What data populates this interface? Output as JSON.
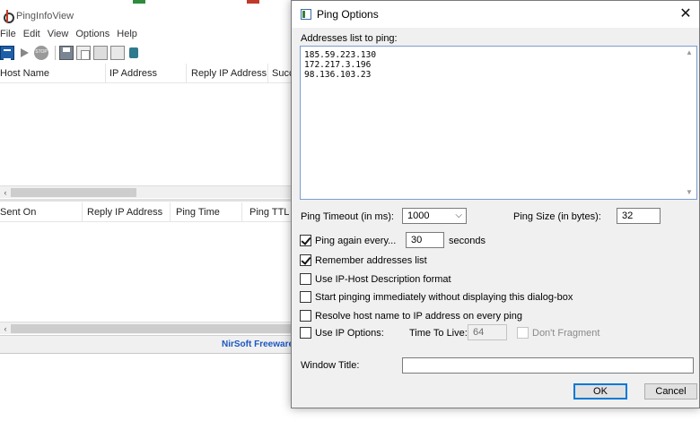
{
  "main_window": {
    "title": "PingInfoView",
    "menu": [
      "File",
      "Edit",
      "View",
      "Options",
      "Help"
    ],
    "toolbar_icons": [
      "list-icon",
      "play-icon",
      "stop-icon",
      "save-icon",
      "copy-icon",
      "html-report-icon",
      "properties-icon",
      "exit-icon"
    ],
    "top_columns": [
      "Host Name",
      "IP Address",
      "Reply IP Address",
      "Succ"
    ],
    "bottom_columns": [
      "Sent On",
      "Reply IP Address",
      "Ping Time",
      "Ping TTL"
    ],
    "status_text": "NirSoft Freeware"
  },
  "dialog": {
    "title": "Ping Options",
    "close_glyph": "✕",
    "addresses_label": "Addresses list to ping:",
    "addresses": [
      "185.59.223.130",
      "172.217.3.196",
      "98.136.103.23"
    ],
    "ping_timeout_label": "Ping Timeout (in ms):",
    "ping_timeout_value": "1000",
    "ping_size_label": "Ping Size (in bytes):",
    "ping_size_value": "32",
    "ping_again_label": "Ping again every...",
    "ping_again_checked": true,
    "ping_again_value": "30",
    "seconds_label": "seconds",
    "remember_label": "Remember addresses list",
    "remember_checked": true,
    "iphost_label": "Use IP-Host Description format",
    "iphost_checked": false,
    "start_immediately_label": "Start pinging immediately without displaying this dialog-box",
    "start_immediately_checked": false,
    "resolve_label": "Resolve host name to IP address on every ping",
    "resolve_checked": false,
    "ip_options_label": "Use IP Options:",
    "ip_options_checked": false,
    "ttl_label": "Time To Live:",
    "ttl_value": "64",
    "dont_fragment_label": "Don't Fragment",
    "dont_fragment_checked": false,
    "window_title_label": "Window Title:",
    "window_title_value": "",
    "ok_label": "OK",
    "cancel_label": "Cancel"
  }
}
